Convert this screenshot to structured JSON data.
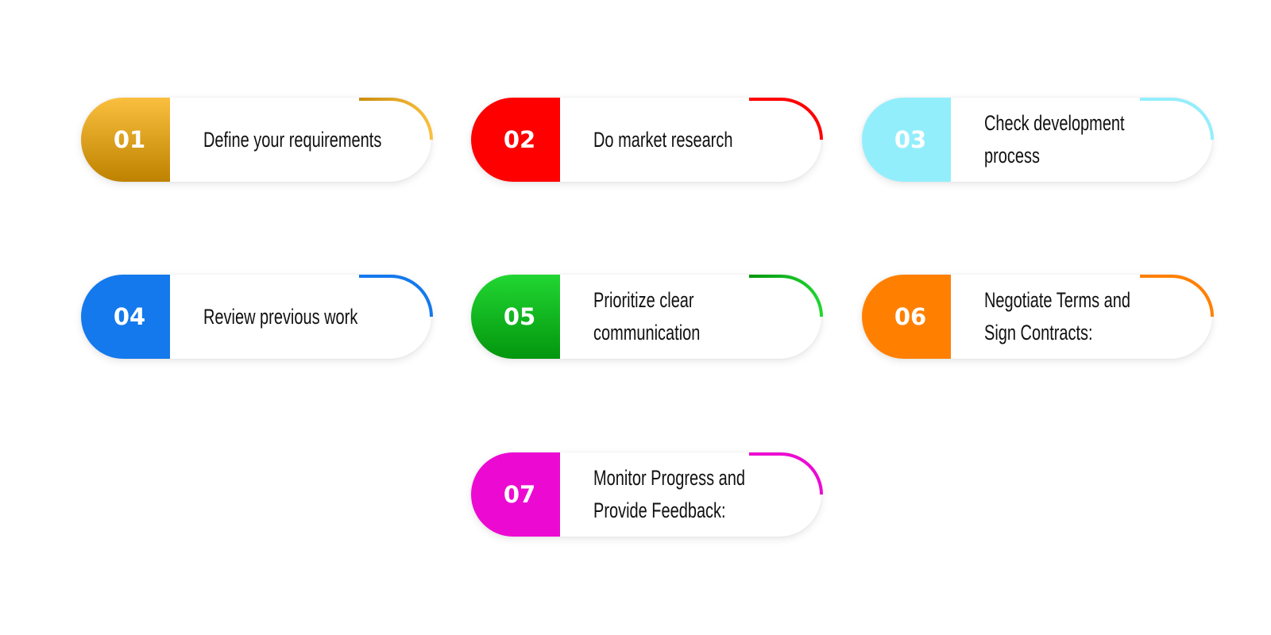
{
  "steps": [
    {
      "number": "01",
      "lines": [
        "Define your requirements"
      ],
      "color_top": "#FBBF3F",
      "color_bottom": "#BE8200",
      "arc_start": "#C98D0C",
      "arc_end": "#FBBF3F"
    },
    {
      "number": "02",
      "lines": [
        "Do market research"
      ],
      "color_top": "#FF0000",
      "color_bottom": "#FF0000",
      "arc_start": "#FF0000",
      "arc_end": "#FF0000"
    },
    {
      "number": "03",
      "lines": [
        "Check development",
        "process"
      ],
      "color_top": "#93EEFC",
      "color_bottom": "#93EEFC",
      "arc_start": "#93EEFC",
      "arc_end": "#93EEFC"
    },
    {
      "number": "04",
      "lines": [
        "Review previous work"
      ],
      "color_top": "#1479EC",
      "color_bottom": "#1479EC",
      "arc_start": "#1479EC",
      "arc_end": "#1479EC"
    },
    {
      "number": "05",
      "lines": [
        "Prioritize clear",
        "communication"
      ],
      "color_top": "#21D632",
      "color_bottom": "#03960E",
      "arc_start": "#03960E",
      "arc_end": "#21D632"
    },
    {
      "number": "06",
      "lines": [
        "Negotiate Terms and",
        "Sign Contracts:"
      ],
      "color_top": "#FF8000",
      "color_bottom": "#FF8000",
      "arc_start": "#FF8000",
      "arc_end": "#FF8000"
    },
    {
      "number": "07",
      "lines": [
        "Monitor Progress and",
        "Provide Feedback:"
      ],
      "color_top": "#EC0AD2",
      "color_bottom": "#EC0AD2",
      "arc_start": "#EC0AD2",
      "arc_end": "#EC0AD2"
    }
  ]
}
